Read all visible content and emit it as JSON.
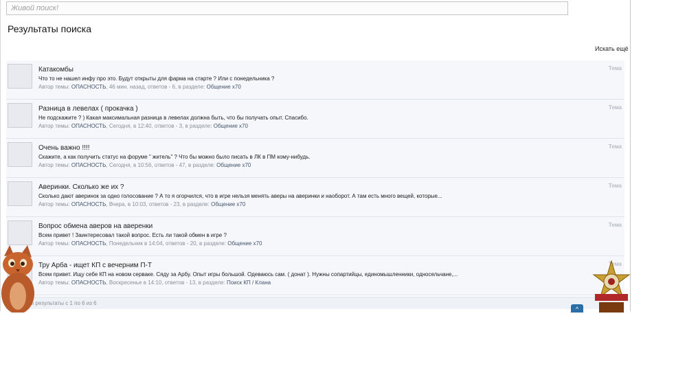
{
  "search": {
    "placeholder": "Живой поиск!"
  },
  "page_title": "Результаты поиска",
  "more_link": "Искать ещё",
  "labels": {
    "author_prefix": "Автор темы:",
    "replies_prefix": "ответов -",
    "section_prefix": "в разделе:"
  },
  "results": [
    {
      "title": "Катакомбы",
      "snippet": "Что то не нашел инфу про это. Будут открыты для фарма на старте ? Или с понедельника ?",
      "author": "ОПАСНОСТЬ",
      "time": "46 мин. назад",
      "replies": "6",
      "forum": "Общение х70",
      "type": "Тема"
    },
    {
      "title": "Разница в левелах ( прокачка )",
      "snippet": "Не подскажите ? ) Какая максимальная разница в левелах должна быть, что бы получать опыт. Спасибо.",
      "author": "ОПАСНОСТЬ",
      "time": "Сегодня, в 12:40",
      "replies": "3",
      "forum": "Общение х70",
      "type": "Тема"
    },
    {
      "title": "Очень важно !!!!",
      "snippet": "Скажите, а как получить статус на форуме \" житель\" ? Что бы можно было писать в ЛК в ПМ кому-нибудь.",
      "author": "ОПАСНОСТЬ",
      "time": "Сегодня, в 10:56",
      "replies": "47",
      "forum": "Общение х70",
      "type": "Тема"
    },
    {
      "title": "Аверинки. Сколько же их ?",
      "snippet": "Сколько дают аверинок за одно голосование ? А то я огорчился, что в игре нельзя менять аверы на аверинки и наоборот. А там есть много вещей, которые...",
      "author": "ОПАСНОСТЬ",
      "time": "Вчера, в 10:03",
      "replies": "23",
      "forum": "Общение х70",
      "type": "Тема"
    },
    {
      "title": "Вопрос обмена аверов на аверенки",
      "snippet": "Всем привет ! Заинтересовал такой вопрос. Есть ли такой обмен в игре ?",
      "author": "ОПАСНОСТЬ",
      "time": "Понедельник в 14:04",
      "replies": "20",
      "forum": "Общение х70",
      "type": "Тема"
    },
    {
      "title": "Тру Арба - ищет КП с вечерним П-Т",
      "snippet": "Всем привет. Ищу себе КП на новом серваке. Сяду за Арбу. Опыт игры большой. Одеваюсь сам. ( донат ). Нужны сопартийцы, единомышленники, односельчане,...",
      "author": "ОПАСНОСТЬ",
      "time": "Воскресенье в 14:10",
      "replies": "13",
      "forum": "Поиск КП / Клана",
      "type": "Тема"
    }
  ],
  "footer": {
    "text": "ны результаты с 1 по 6 из 6"
  },
  "scroll_top": {
    "icon": "chevron-up-icon",
    "glyph": "^"
  },
  "colors": {
    "accent": "#2a6ea8",
    "row_bg": "#f5f7fa",
    "meta": "#8a8f98"
  }
}
